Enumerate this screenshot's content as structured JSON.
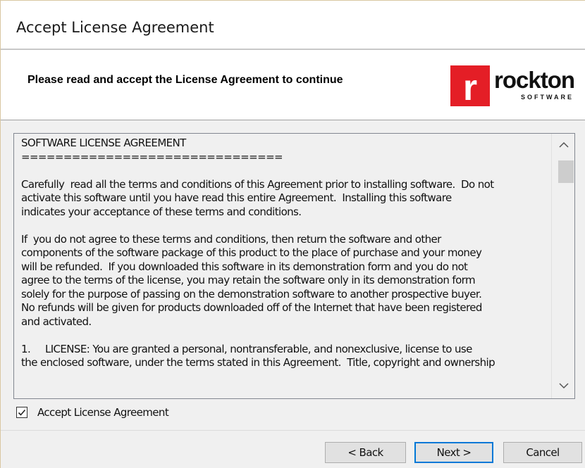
{
  "window": {
    "title": "Accept License Agreement"
  },
  "header": {
    "instruction": "Please read and accept the License Agreement to continue",
    "logo": {
      "letter": "r",
      "word": "rockton",
      "sub": "SOFTWARE",
      "brand_color": "#e41e26"
    }
  },
  "license": {
    "text": "SOFTWARE LICENSE AGREEMENT\n===============================\n\nCarefully  read all the terms and conditions of this Agreement prior to installing software.  Do not\nactivate this software until you have read this entire Agreement.  Installing this software\nindicates your acceptance of these terms and conditions.\n\nIf  you do not agree to these terms and conditions, then return the software and other\ncomponents of the software package of this product to the place of purchase and your money\nwill be refunded.  If you downloaded this software in its demonstration form and you do not\nagree to the terms of the license, you may retain the software only in its demonstration form\nsolely for the purpose of passing on the demonstration software to another prospective buyer.\nNo refunds will be given for products downloaded off of the Internet that have been registered\nand activated.\n\n1.     LICENSE: You are granted a personal, nontransferable, and nonexclusive, license to use\nthe enclosed software, under the terms stated in this Agreement.  Title, copyright and ownership",
    "scroll_up_icon": "chevron-up-icon",
    "scroll_down_icon": "chevron-down-icon"
  },
  "accept": {
    "label": "Accept License Agreement",
    "checked": true
  },
  "buttons": {
    "back": "< Back",
    "next": "Next >",
    "cancel": "Cancel"
  }
}
